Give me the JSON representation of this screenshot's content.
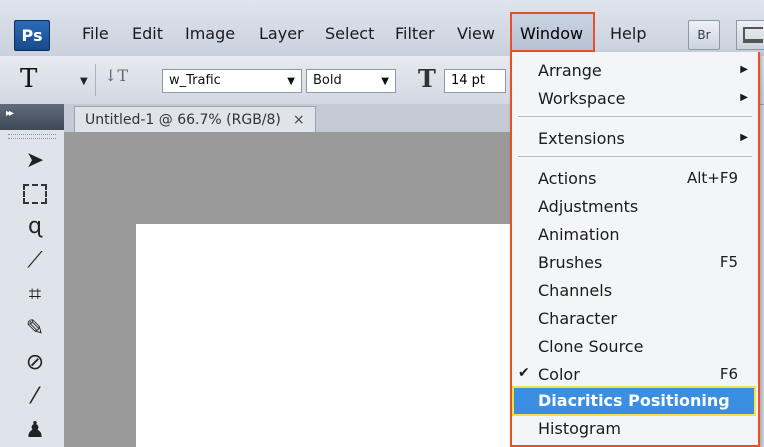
{
  "app": {
    "logo": "Ps"
  },
  "menubar": {
    "items": [
      "File",
      "Edit",
      "Image",
      "Layer",
      "Select",
      "Filter",
      "View",
      "Window",
      "Help"
    ],
    "bridge_label": "Br"
  },
  "options_bar": {
    "tool_glyph": "T",
    "orient_glyph": "↓T",
    "font_family": "w_Trafic",
    "font_style": "Bold",
    "size_glyph": "T",
    "font_size": "14 pt"
  },
  "document": {
    "tab_title": "Untitled-1 @ 66.7% (RGB/8)",
    "close_glyph": "×"
  },
  "tools_panel": {
    "collapse_glyph": "▸▸"
  },
  "window_menu": {
    "items": [
      {
        "label": "Arrange",
        "submenu": true
      },
      {
        "label": "Workspace",
        "submenu": true
      },
      {
        "label": "Extensions",
        "submenu": true
      },
      {
        "label": "Actions",
        "shortcut": "Alt+F9"
      },
      {
        "label": "Adjustments"
      },
      {
        "label": "Animation"
      },
      {
        "label": "Brushes",
        "shortcut": "F5"
      },
      {
        "label": "Channels"
      },
      {
        "label": "Character"
      },
      {
        "label": "Clone Source"
      },
      {
        "label": "Color",
        "shortcut": "F6",
        "checked": true
      },
      {
        "label": "Diacritics Positioning",
        "highlighted": true
      },
      {
        "label": "Histogram"
      }
    ]
  },
  "colors": {
    "highlight": "#3b8fe2",
    "callout_border": "#e8502a",
    "highlight_outline": "#f1e24a"
  }
}
